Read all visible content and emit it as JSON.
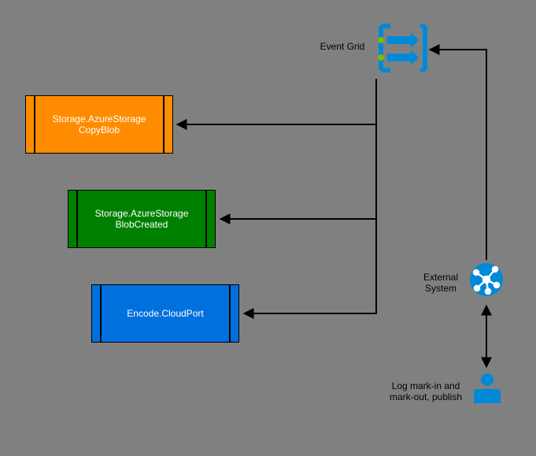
{
  "nodes": {
    "event_grid": {
      "label": "Event Grid"
    },
    "storage_copy_blob": {
      "label_l1": "Storage.AzureStorage",
      "label_l2": "CopyBlob"
    },
    "storage_blob_created": {
      "label_l1": "Storage.AzureStorage",
      "label_l2": "BlobCreated"
    },
    "encode_cloudport": {
      "label": "Encode.CloudPort"
    },
    "external_system": {
      "label_l1": "External",
      "label_l2": "System"
    },
    "user": {
      "label_l1": "Log mark-in and",
      "label_l2": "mark-out, publish"
    }
  },
  "colors": {
    "orange": "#ff8c00",
    "green": "#008000",
    "blue": "#0070dd",
    "azure_blue": "#0089d6",
    "azure_accent": "#7fba00"
  }
}
